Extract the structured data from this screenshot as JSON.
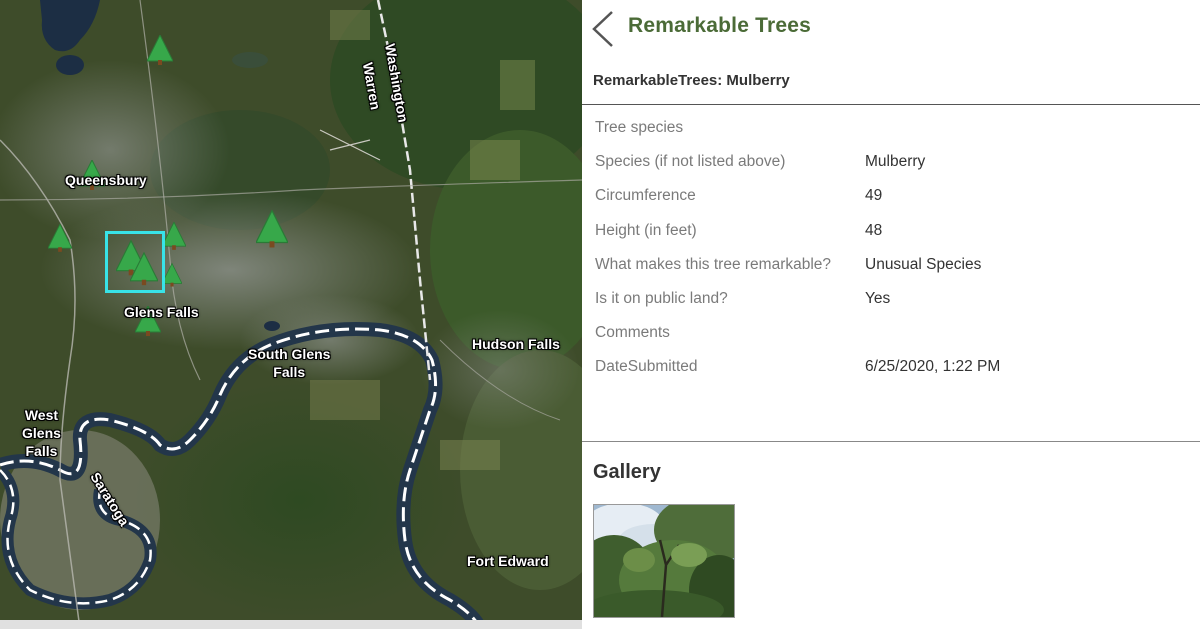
{
  "map": {
    "labels": [
      {
        "text": "Queensbury"
      },
      {
        "text": "Glens Falls"
      },
      {
        "text": "South Glens\nFalls"
      },
      {
        "text": "West\nGlens\nFalls"
      },
      {
        "text": "Hudson Falls"
      },
      {
        "text": "Fort Edward"
      },
      {
        "text": "Washington"
      },
      {
        "text": "Warren"
      },
      {
        "text": "Saratoga"
      }
    ],
    "marker_icon": "tree-marker-icon",
    "selection_color": "#38e3e8"
  },
  "panel": {
    "title": "Remarkable Trees",
    "subtitle": "RemarkableTrees: Mulberry",
    "title_color": "#4b6b37",
    "fields": [
      {
        "label": "Tree species",
        "value": ""
      },
      {
        "label": "Species (if not listed above)",
        "value": "Mulberry"
      },
      {
        "label": "Circumference",
        "value": "49"
      },
      {
        "label": "Height (in feet)",
        "value": "48"
      },
      {
        "label": "What makes this tree remarkable?",
        "value": "Unusual Species"
      },
      {
        "label": "Is it on public land?",
        "value": "Yes"
      },
      {
        "label": "Comments",
        "value": ""
      },
      {
        "label": "DateSubmitted",
        "value": "6/25/2020, 1:22 PM"
      }
    ],
    "gallery_title": "Gallery",
    "back_icon": "chevron-left-icon"
  }
}
